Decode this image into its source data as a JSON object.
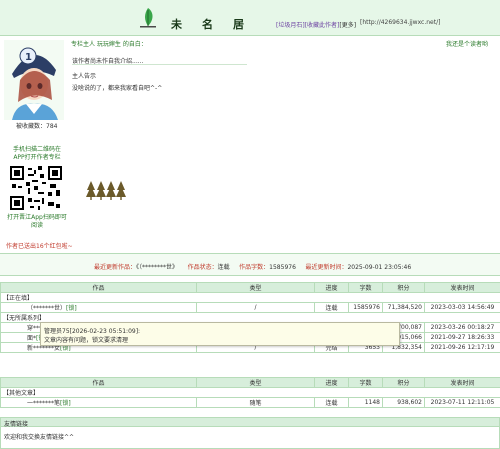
{
  "header": {
    "site_name": "未名居",
    "link_trash": "[垃圾月石]",
    "link_collect": "[收藏此作者]",
    "link_more": "[更多]",
    "url": "[http://4269634.jjwxc.net/]"
  },
  "profile": {
    "column_owner": "专栏主人 玩玩婶生 的自白：",
    "greeting": "我还是个读者哟",
    "notice_line1": "该作者尚未作自我介绍......",
    "notice_line2": "主人告示",
    "notice_line3": "没啥说的了，都来我家看自吧^-^",
    "collect_count": "被收藏数：784",
    "qr_caption_top": "手机扫描二维码在APP打开作者专栏",
    "qr_caption_bottom": "打开晋江App扫码即可阅读",
    "redbag": "作者已送出16个红包啦~"
  },
  "update": {
    "latest_label": "最近更新作品：",
    "latest_value": "《（********世》",
    "status_label": "作品状态：",
    "status_value": "连载",
    "words_label": "作品字数：",
    "words_value": "1585976",
    "time_label": "最近更新时间：",
    "time_value": "2025-09-01 23:05:46"
  },
  "table1": {
    "headers": [
      "作品",
      "类型",
      "进度",
      "字数",
      "积分",
      "发表时间"
    ],
    "section_ongoing": "【正在填】",
    "section_series": "【无所属系列】",
    "rows_ongoing": [
      {
        "title": "（*******世）",
        "tag": "[锁]",
        "type": "/",
        "progress": "连载",
        "words": "1585976",
        "score": "71,384,520",
        "date": "2023-03-03 14:56:49"
      }
    ],
    "rows_series": [
      {
        "title": "穿*****",
        "tag": "",
        "type": "",
        "progress": "",
        "words": "",
        "score": "700,087",
        "date": "2023-03-26 00:18:27"
      },
      {
        "title": "面*",
        "tag": "[锁]",
        "type": "/",
        "progress": "连载",
        "words": "2164",
        "score": "915,066",
        "date": "2021-09-27 18:26:33"
      },
      {
        "title": "新*******女",
        "tag": "[锁]",
        "type": "/",
        "progress": "完结",
        "words": "3653",
        "score": "1,832,354",
        "date": "2021-09-26 12:17:19"
      }
    ]
  },
  "table2": {
    "headers": [
      "作品",
      "类型",
      "进度",
      "字数",
      "积分",
      "发表时间"
    ],
    "section_other": "【其他文章】",
    "rows": [
      {
        "title": "一*******笔",
        "tag": "[锁]",
        "type": "随笔",
        "progress": "连载",
        "words": "1148",
        "score": "938,602",
        "date": "2023-07-11 12:11:05"
      }
    ]
  },
  "popup": {
    "title": "管理员75[2026-02-23 05:51:09]:",
    "body": "文章内容有问题，锁文要求清理"
  },
  "friends": {
    "head": "友情链接",
    "text": "欢迎和我交换友情链接^^"
  },
  "colors": {
    "accent_green": "#2a7a2a",
    "header_bg": "#e6f7e8",
    "table_head_bg": "#d7eedb",
    "alert_red": "#c0392b"
  },
  "icons": [
    "leaf-logo-icon",
    "avatar-image",
    "qr-code",
    "tree-decoration-icon"
  ]
}
